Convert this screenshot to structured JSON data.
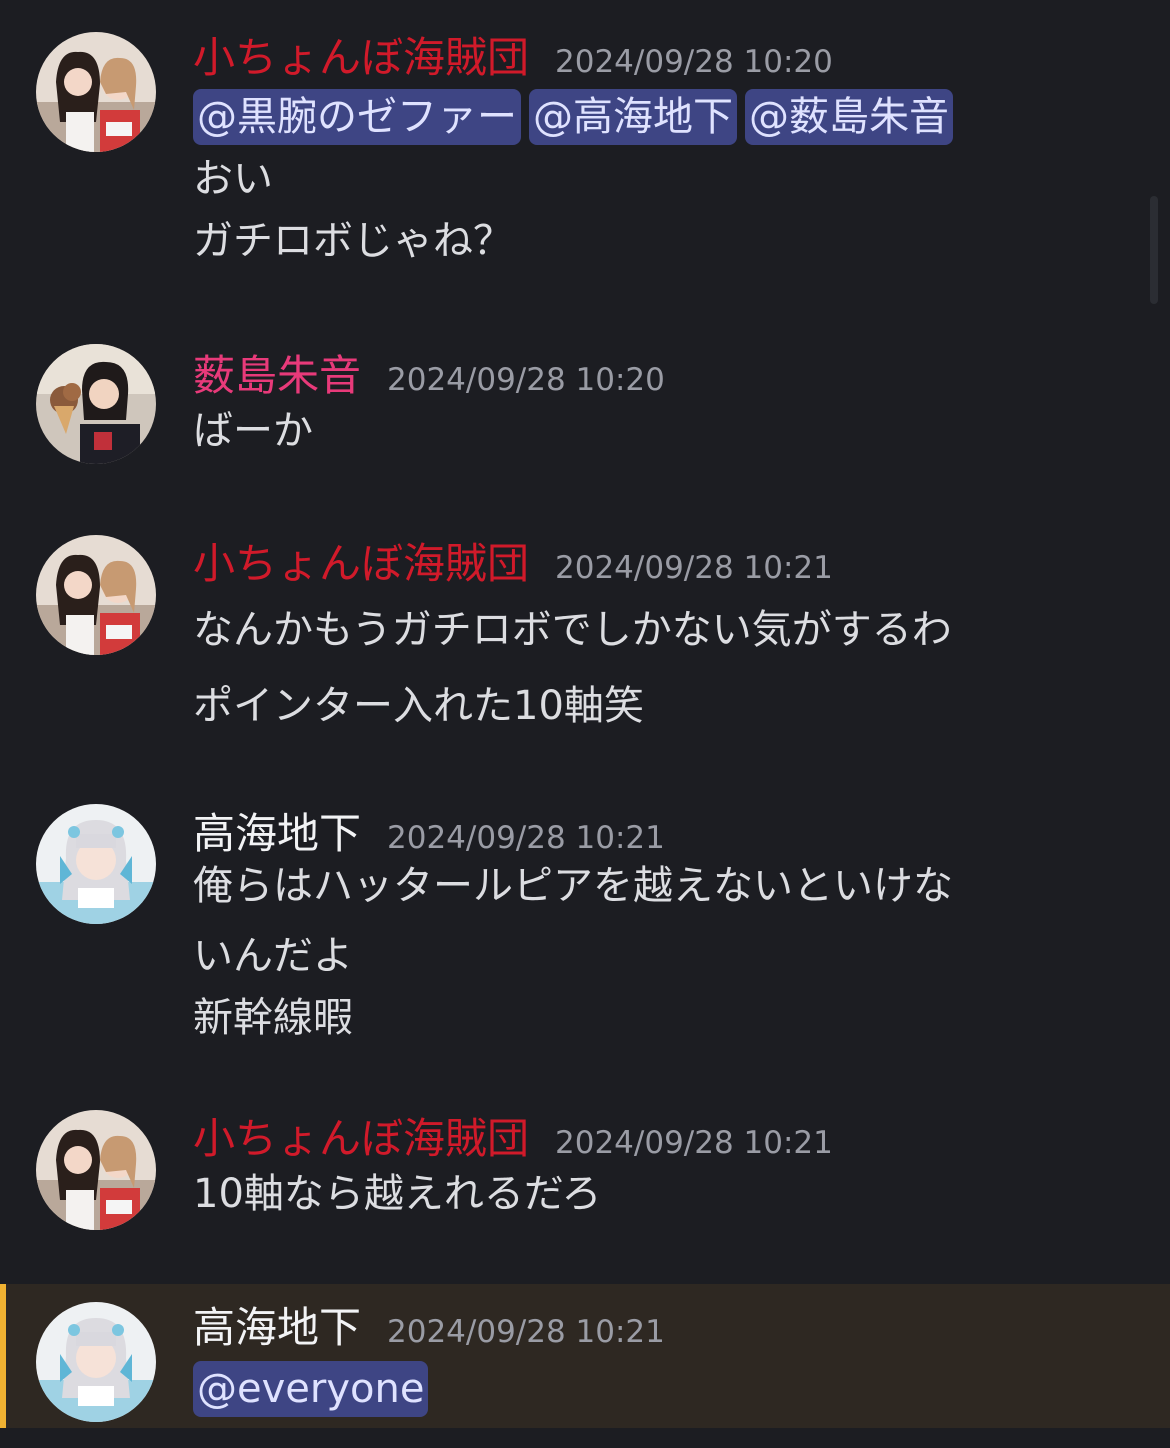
{
  "colors": {
    "background": "#1c1d22",
    "pirate_name": "#d11a2a",
    "yabushima_name": "#e83a7a",
    "takami_name": "#f2f3f5",
    "mention_bg": "#3e4584",
    "highlight_bg": "#2e2822",
    "highlight_bar": "#f0b232"
  },
  "messages": [
    {
      "username": "小ちょんぼ海賊団",
      "timestamp": "2024/09/28 10:20",
      "avatar": "duo-photo-avatar",
      "mentions": [
        "@黒腕のゼファー",
        "@高海地下",
        "@薮島朱音"
      ],
      "lines": [
        "おい",
        "ガチロボじゃね？"
      ]
    },
    {
      "username": "薮島朱音",
      "timestamp": "2024/09/28 10:20",
      "avatar": "selfie-icecream-avatar",
      "lines": [
        "ばーか"
      ]
    },
    {
      "username": "小ちょんぼ海賊団",
      "timestamp": "2024/09/28 10:21",
      "avatar": "duo-photo-avatar",
      "lines": [
        "なんかもうガチロボでしかない気がするわ",
        "ポインター入れた10軸笑"
      ]
    },
    {
      "username": "高海地下",
      "timestamp": "2024/09/28 10:21",
      "avatar": "idol-blue-avatar",
      "lines": [
        "俺らはハッタールピアを越えないといけな",
        "いんだよ",
        "新幹線暇"
      ]
    },
    {
      "username": "小ちょんぼ海賊団",
      "timestamp": "2024/09/28 10:21",
      "avatar": "duo-photo-avatar",
      "lines": [
        "10軸なら越えれるだろ"
      ]
    },
    {
      "username": "高海地下",
      "timestamp": "2024/09/28 10:21",
      "avatar": "idol-blue-avatar",
      "mentions": [
        "@everyone"
      ],
      "lines": []
    }
  ]
}
